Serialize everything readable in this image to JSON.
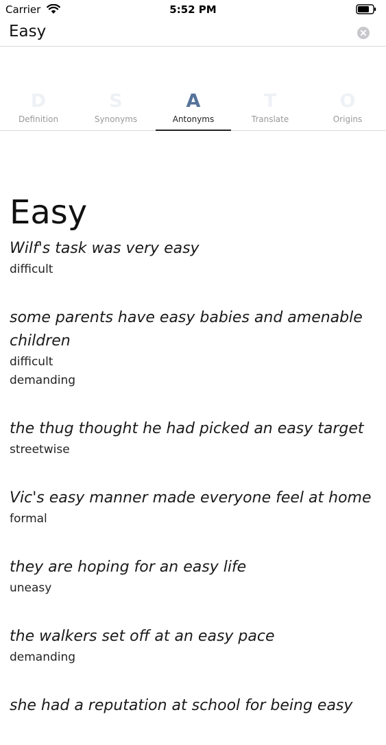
{
  "status_bar": {
    "carrier": "Carrier",
    "time": "5:52 PM"
  },
  "search": {
    "value": "Easy",
    "placeholder": ""
  },
  "tabs": [
    {
      "letter": "D",
      "label": "Definition",
      "active": false
    },
    {
      "letter": "S",
      "label": "Synonyms",
      "active": false
    },
    {
      "letter": "A",
      "label": "Antonyms",
      "active": true
    },
    {
      "letter": "T",
      "label": "Translate",
      "active": false
    },
    {
      "letter": "O",
      "label": "Origins",
      "active": false
    }
  ],
  "content": {
    "headword": "Easy",
    "entries": [
      {
        "example": "Wilf's task was very easy",
        "antonyms": [
          "difficult"
        ]
      },
      {
        "example": "some parents have easy babies and amenable children",
        "antonyms": [
          "difficult",
          "demanding"
        ]
      },
      {
        "example": "the thug thought he had picked an easy target",
        "antonyms": [
          "streetwise"
        ]
      },
      {
        "example": "Vic's easy manner made everyone feel at home",
        "antonyms": [
          "formal"
        ]
      },
      {
        "example": "they are hoping for an easy life",
        "antonyms": [
          "uneasy"
        ]
      },
      {
        "example": "the walkers set off at an easy pace",
        "antonyms": [
          "demanding"
        ]
      },
      {
        "example": "she had a reputation at school for being easy",
        "antonyms": []
      }
    ]
  },
  "colors": {
    "active_tab_letter": "#557399",
    "inactive_tab_letter": "#eef1f5",
    "divider": "#d9d9d9"
  },
  "icons": {
    "wifi": "wifi-icon",
    "battery": "battery-icon",
    "clear": "clear-icon"
  }
}
